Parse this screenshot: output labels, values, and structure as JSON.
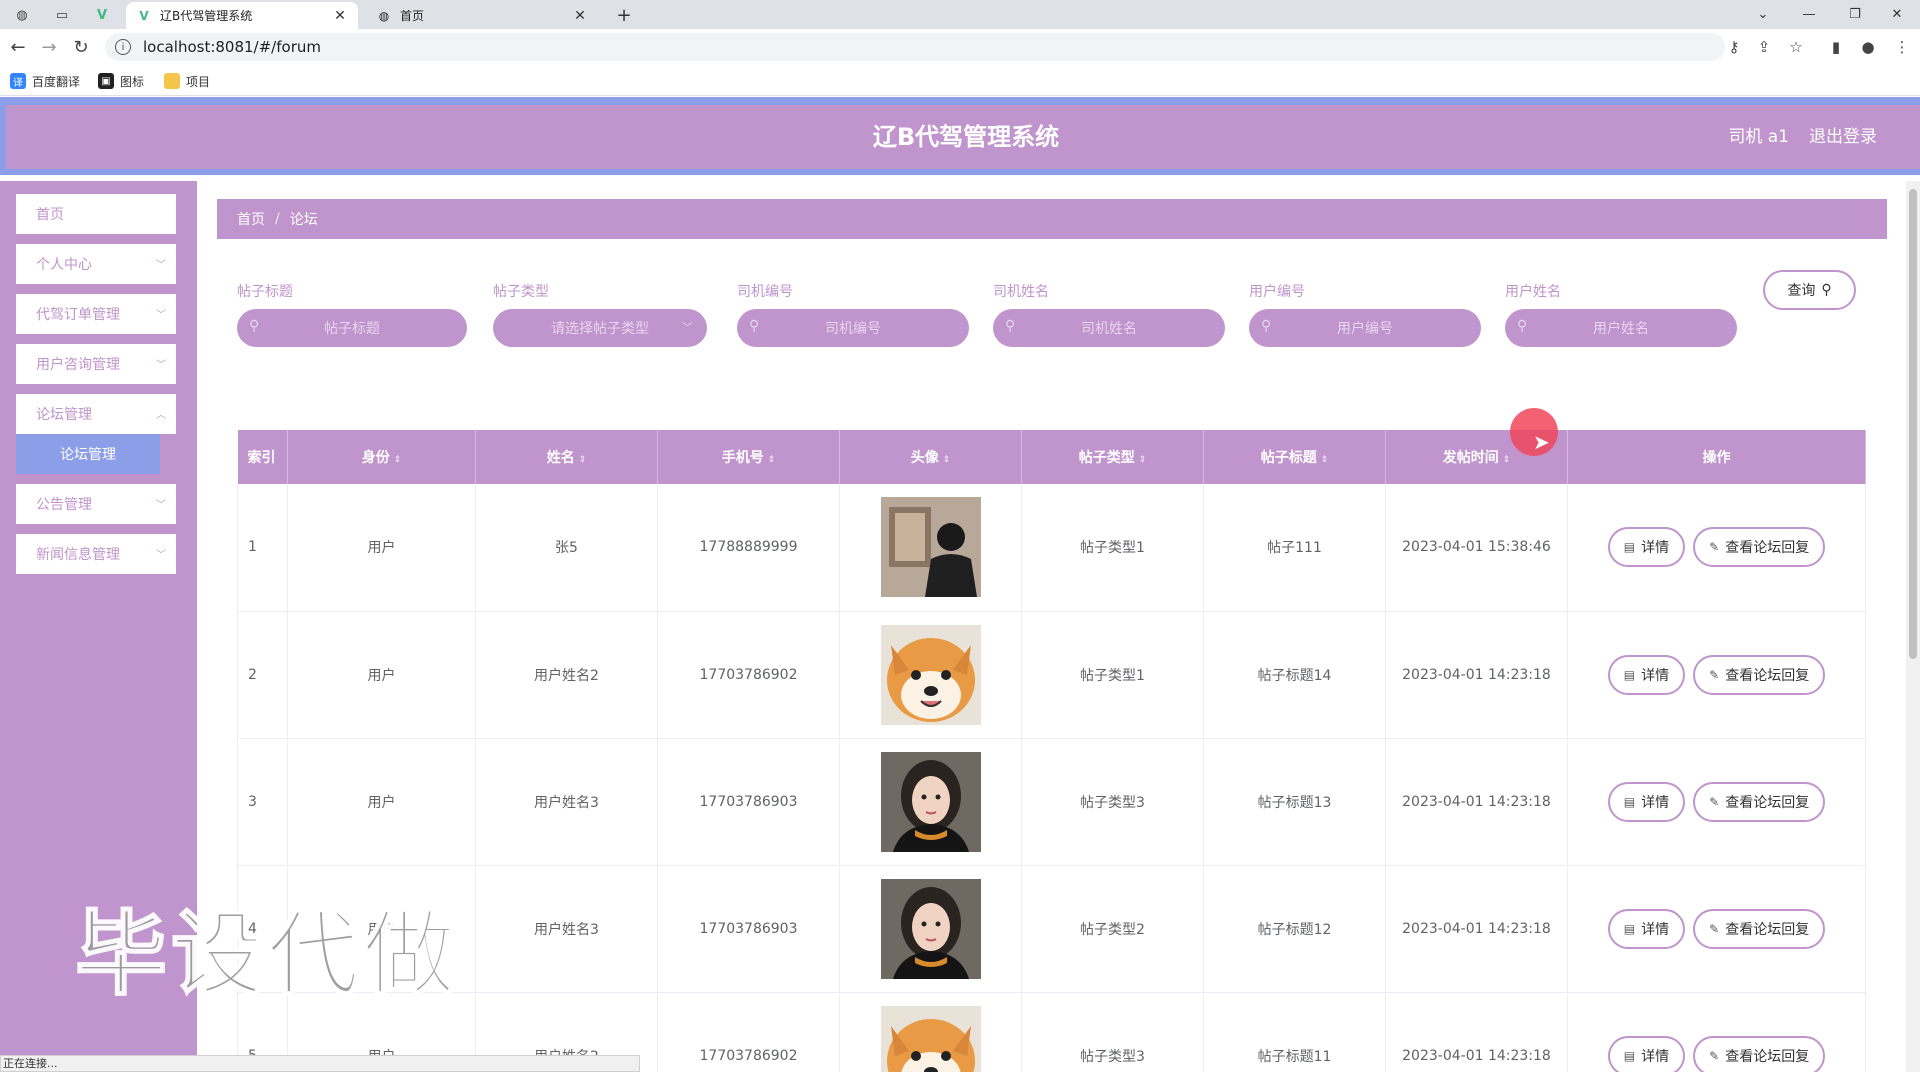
{
  "browser": {
    "tabs": [
      {
        "title": "辽B代驾管理系统",
        "active": true
      },
      {
        "title": "首页",
        "active": false
      }
    ],
    "url": "localhost:8081/#/forum",
    "bookmarks": [
      "百度翻译",
      "图标",
      "项目"
    ],
    "status_text": "正在连接..."
  },
  "header": {
    "title": "辽B代驾管理系统",
    "user": "司机 a1",
    "logout": "退出登录"
  },
  "sidebar": {
    "items": [
      {
        "label": "首页",
        "has_children": false
      },
      {
        "label": "个人中心",
        "has_children": true
      },
      {
        "label": "代驾订单管理",
        "has_children": true
      },
      {
        "label": "用户咨询管理",
        "has_children": true
      },
      {
        "label": "论坛管理",
        "has_children": true
      },
      {
        "label": "公告管理",
        "has_children": true
      },
      {
        "label": "新闻信息管理",
        "has_children": true
      }
    ],
    "active_sub": "论坛管理"
  },
  "breadcrumb": {
    "home": "首页",
    "current": "论坛"
  },
  "search": {
    "fields": [
      {
        "label": "帖子标题",
        "placeholder": "帖子标题",
        "type": "input"
      },
      {
        "label": "帖子类型",
        "placeholder": "请选择帖子类型",
        "type": "select"
      },
      {
        "label": "司机编号",
        "placeholder": "司机编号",
        "type": "input"
      },
      {
        "label": "司机姓名",
        "placeholder": "司机姓名",
        "type": "input"
      },
      {
        "label": "用户编号",
        "placeholder": "用户编号",
        "type": "input"
      },
      {
        "label": "用户姓名",
        "placeholder": "用户姓名",
        "type": "input"
      }
    ],
    "query_label": "查询"
  },
  "table": {
    "columns": [
      "索引",
      "身份",
      "姓名",
      "手机号",
      "头像",
      "帖子类型",
      "帖子标题",
      "发帖时间",
      "操作"
    ],
    "rows": [
      {
        "index": "1",
        "role": "用户",
        "name": "张5",
        "phone": "17788889999",
        "avatar": "person-back",
        "type": "帖子类型1",
        "title": "帖子111",
        "time": "2023-04-01 15:38:46"
      },
      {
        "index": "2",
        "role": "用户",
        "name": "用户姓名2",
        "phone": "17703786902",
        "avatar": "shiba-dog",
        "type": "帖子类型1",
        "title": "帖子标题14",
        "time": "2023-04-01 14:23:18"
      },
      {
        "index": "3",
        "role": "用户",
        "name": "用户姓名3",
        "phone": "17703786903",
        "avatar": "girl-portrait",
        "type": "帖子类型3",
        "title": "帖子标题13",
        "time": "2023-04-01 14:23:18"
      },
      {
        "index": "4",
        "role": "用户",
        "name": "用户姓名3",
        "phone": "17703786903",
        "avatar": "girl-portrait",
        "type": "帖子类型2",
        "title": "帖子标题12",
        "time": "2023-04-01 14:23:18"
      },
      {
        "index": "5",
        "role": "用户",
        "name": "用户姓名2",
        "phone": "17703786902",
        "avatar": "shiba-dog",
        "type": "帖子类型3",
        "title": "帖子标题11",
        "time": "2023-04-01 14:23:18"
      }
    ],
    "detail_label": "详情",
    "reply_label": "查看论坛回复"
  },
  "watermark": "毕设代做",
  "colors": {
    "primary": "#c094cc",
    "accent": "#8c9ee8"
  }
}
